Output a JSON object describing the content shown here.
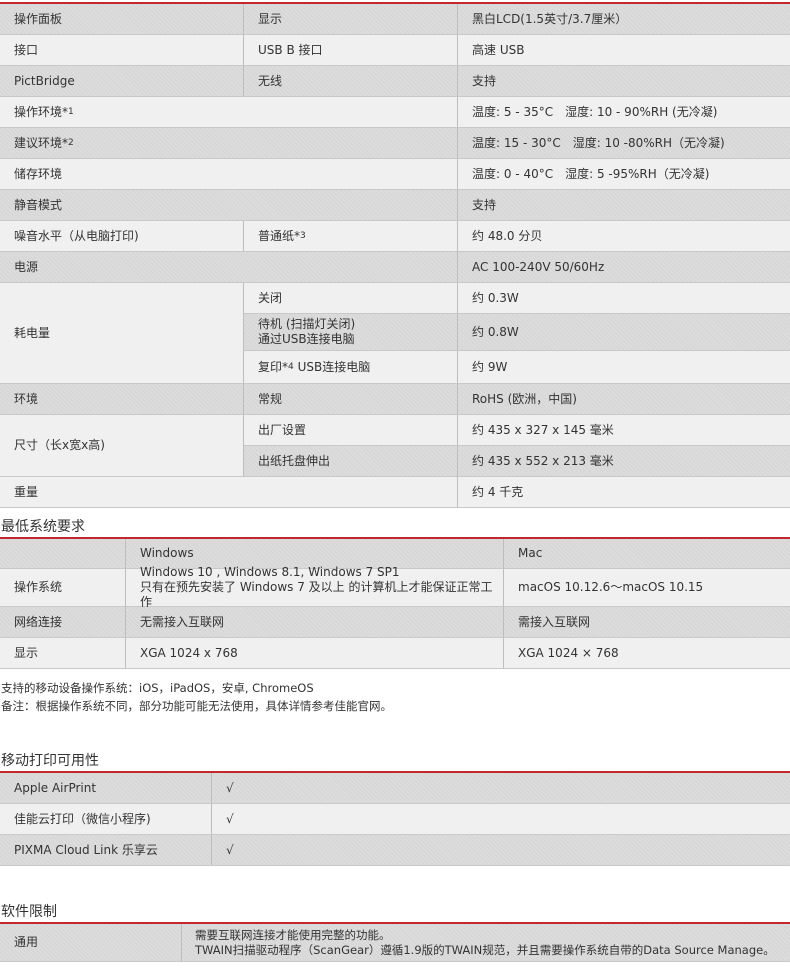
{
  "spec_table": {
    "rows": [
      {
        "c1": "操作面板",
        "c2": "显示",
        "c3": "黑白LCD(1.5英寸/3.7厘米）"
      },
      {
        "c1": "接口",
        "c2": "USB B 接口",
        "c3": "高速 USB"
      },
      {
        "c1": "PictBridge",
        "c2": "无线",
        "c3": "支持"
      },
      {
        "c1": "操作环境*",
        "c1_sup": "1",
        "c3": "温度: 5 - 35°C　湿度: 10 - 90%RH (无冷凝)"
      },
      {
        "c1": "建议环境*",
        "c1_sup": "2",
        "c3": "温度: 15 - 30°C　湿度: 10 -80%RH（无冷凝)"
      },
      {
        "c1": "储存环境",
        "c3": "温度: 0 - 40°C　湿度: 5 -95%RH（无冷凝)"
      },
      {
        "c1": "静音模式",
        "c3": "支持"
      },
      {
        "c1": "噪音水平（从电脑打印)",
        "c2": "普通纸*",
        "c2_sup": "3",
        "c3": "约 48.0 分贝"
      },
      {
        "c1": "电源",
        "c3": "AC 100-240V 50/60Hz"
      }
    ],
    "power": {
      "label": "耗电量",
      "off_label": "关闭",
      "off_value": "约 0.3W",
      "standby_line1": "待机 (扫描灯关闭)",
      "standby_line2": "通过USB连接电脑",
      "standby_value": "约 0.8W",
      "copy_label": "复印*",
      "copy_sup": "4",
      "copy_suffix": " USB连接电脑",
      "copy_value": "约 9W"
    },
    "environment": {
      "label": "环境",
      "sub": "常规",
      "value": "RoHS (欧洲，中国)"
    },
    "dimensions": {
      "label": "尺寸（长x宽x高)",
      "factory_label": "出厂设置",
      "factory_value": "约 435 x 327 x 145 毫米",
      "tray_label": "出纸托盘伸出",
      "tray_value": "约 435 x 552 x 213 毫米"
    },
    "weight": {
      "label": "重量",
      "value": "约 4 千克"
    }
  },
  "system_requirements": {
    "heading": "最低系统要求",
    "header": {
      "windows": "Windows",
      "mac": "Mac"
    },
    "os_label": "操作系统",
    "os_windows_line1": "Windows 10 , Windows 8.1, Windows 7 SP1",
    "os_windows_line2": "只有在预先安装了 Windows 7 及以上 的计算机上才能保证正常工作",
    "os_mac": "macOS 10.12.6～macOS 10.15",
    "net_label": "网络连接",
    "net_windows": "无需接入互联网",
    "net_mac": "需接入互联网",
    "display_label": "显示",
    "display_windows": "XGA 1024 x 768",
    "display_mac": "XGA 1024 × 768"
  },
  "notes": {
    "line1": "支持的移动设备操作系统：iOS，iPadOS，安卓, ChromeOS",
    "line2": "备注：根据操作系统不同，部分功能可能无法使用，具体详情参考佳能官网。"
  },
  "mobile": {
    "heading": "移动打印可用性",
    "rows": [
      {
        "label": "Apple AirPrint",
        "value": "√"
      },
      {
        "label": "佳能云打印（微信小程序)",
        "value": "√"
      },
      {
        "label": "PIXMA Cloud Link 乐享云",
        "value": "√"
      }
    ]
  },
  "software": {
    "heading": "软件限制",
    "label": "通用",
    "line1": "需要互联网连接才能使用完整的功能。",
    "line2": "TWAIN扫描驱动程序（ScanGear）遵循1.9版的TWAIN规范，并且需要操作系统自带的Data Source Manage。"
  },
  "colors": {
    "accent": "#c0282d",
    "gray_cell": "#dcdcdc",
    "light_cell": "#f0f0f0"
  }
}
